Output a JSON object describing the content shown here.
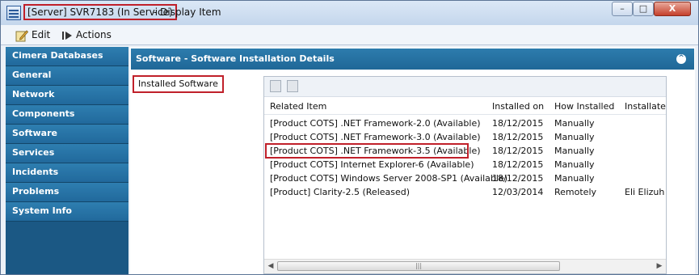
{
  "window": {
    "title_highlight": "[Server] SVR7183 (In Service)",
    "title_rest": "- Display Item",
    "minimize_glyph": "–",
    "maximize_glyph": "□",
    "close_glyph": "X"
  },
  "toolbar": {
    "edit_label": "Edit",
    "actions_label": "Actions"
  },
  "sidebar": {
    "items": [
      {
        "label": "Cimera Databases"
      },
      {
        "label": "General"
      },
      {
        "label": "Network"
      },
      {
        "label": "Components"
      },
      {
        "label": "Software"
      },
      {
        "label": "Services"
      },
      {
        "label": "Incidents"
      },
      {
        "label": "Problems"
      },
      {
        "label": "System Info"
      }
    ]
  },
  "section": {
    "title": "Software - Software Installation Details",
    "collapse_glyph": "^"
  },
  "tab": {
    "installed_software": "Installed Software"
  },
  "grid": {
    "columns": [
      "Related Item",
      "Installed on",
      "How Installed",
      "Installated"
    ],
    "rows": [
      {
        "item": "[Product COTS] .NET Framework-2.0 (Available)",
        "installed_on": "18/12/2015",
        "how": "Manually",
        "by": ""
      },
      {
        "item": "[Product COTS] .NET Framework-3.0 (Available)",
        "installed_on": "18/12/2015",
        "how": "Manually",
        "by": ""
      },
      {
        "item": "[Product COTS] .NET Framework-3.5 (Available)",
        "installed_on": "18/12/2015",
        "how": "Manually",
        "by": ""
      },
      {
        "item": "[Product COTS] Internet Explorer-6 (Available)",
        "installed_on": "18/12/2015",
        "how": "Manually",
        "by": ""
      },
      {
        "item": "[Product COTS] Windows Server 2008-SP1 (Available)",
        "installed_on": "18/12/2015",
        "how": "Manually",
        "by": ""
      },
      {
        "item": "[Product] Clarity-2.5 (Released)",
        "installed_on": "12/03/2014",
        "how": "Remotely",
        "by": "Eli Elizuh"
      }
    ],
    "scroll_left": "◀",
    "scroll_right": "▶",
    "scroll_grip": "|||"
  }
}
